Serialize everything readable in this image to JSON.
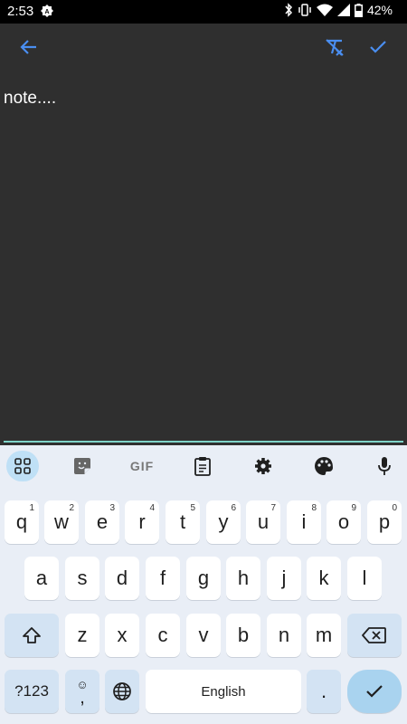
{
  "status_bar": {
    "time": "2:53",
    "battery": "42%"
  },
  "editor": {
    "text": "note...."
  },
  "toolbar": {
    "back_icon": "arrow-left-icon",
    "format_clear_icon": "format-clear-icon",
    "confirm_icon": "check-icon"
  },
  "keyboard": {
    "top_icons": [
      "apps-grid-icon",
      "sticker-icon",
      "gif-icon",
      "clipboard-icon",
      "settings-icon",
      "palette-icon",
      "microphone-icon"
    ],
    "gif_label": "GIF",
    "row1": [
      {
        "k": "q",
        "h": "1"
      },
      {
        "k": "w",
        "h": "2"
      },
      {
        "k": "e",
        "h": "3"
      },
      {
        "k": "r",
        "h": "4"
      },
      {
        "k": "t",
        "h": "5"
      },
      {
        "k": "y",
        "h": "6"
      },
      {
        "k": "u",
        "h": "7"
      },
      {
        "k": "i",
        "h": "8"
      },
      {
        "k": "o",
        "h": "9"
      },
      {
        "k": "p",
        "h": "0"
      }
    ],
    "row2": [
      "a",
      "s",
      "d",
      "f",
      "g",
      "h",
      "j",
      "k",
      "l"
    ],
    "row3": [
      "z",
      "x",
      "c",
      "v",
      "b",
      "n",
      "m"
    ],
    "symbols_label": "?123",
    "comma_label": ",",
    "space_label": "English",
    "period_label": "."
  },
  "colors": {
    "accent": "#4a8ef0",
    "app_bg": "#2f2f2f",
    "keyboard_bg": "#e9eef6",
    "underline": "#7fd3c8"
  }
}
